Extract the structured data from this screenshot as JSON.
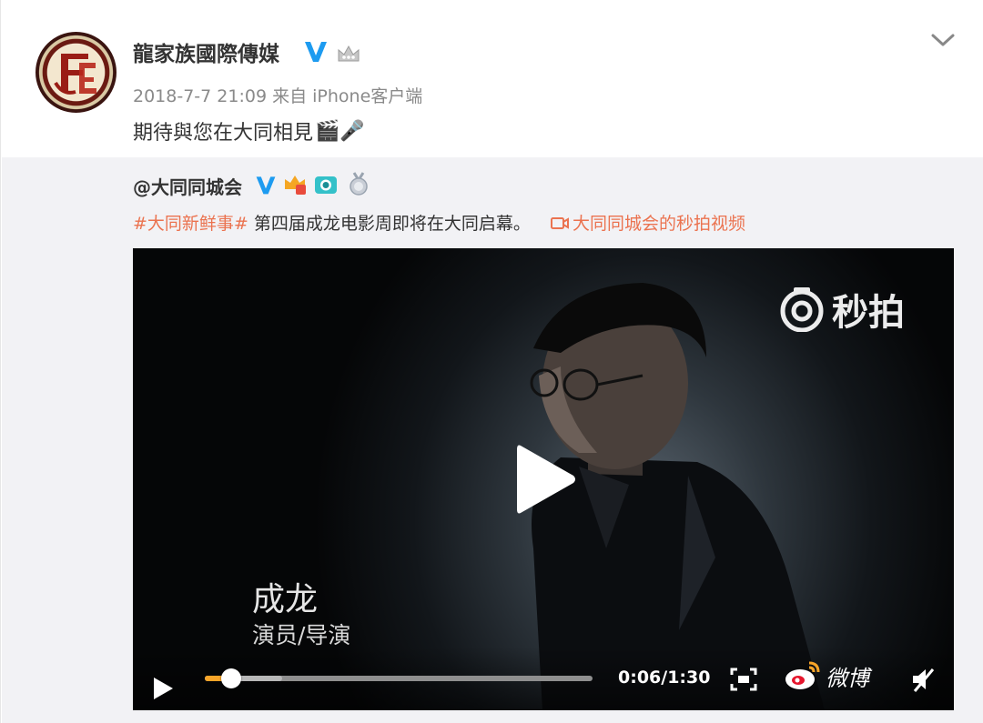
{
  "post": {
    "author": "龍家族國際傳媒",
    "timestamp": "2018-7-7 21:09",
    "source": "来自 iPhone客户端",
    "text": "期待與您在大同相見",
    "text_emoji": "🎬🎤"
  },
  "repost": {
    "author": "@大同同城会",
    "hashtag": "#大同新鲜事#",
    "text": " 第四届成龙电影周即将在大同启幕。",
    "video_link": "大同同城会的秒拍视频"
  },
  "video": {
    "watermark": "秒拍",
    "subtitle_name": "成龙",
    "subtitle_role": "演员/导演",
    "time_display": "0:06/1:30",
    "progress": 0.067,
    "buffered": 0.2,
    "logo_text": "微博"
  },
  "icons": {
    "verified": "verified-v-icon",
    "crown": "crown-icon",
    "menu": "chevron-down-icon",
    "play": "play-icon",
    "fullscreen": "fullscreen-icon",
    "mute": "mute-icon"
  },
  "colors": {
    "accent_link": "#eb7350",
    "verified_blue": "#1d9bf0",
    "progress": "#f7a428"
  }
}
